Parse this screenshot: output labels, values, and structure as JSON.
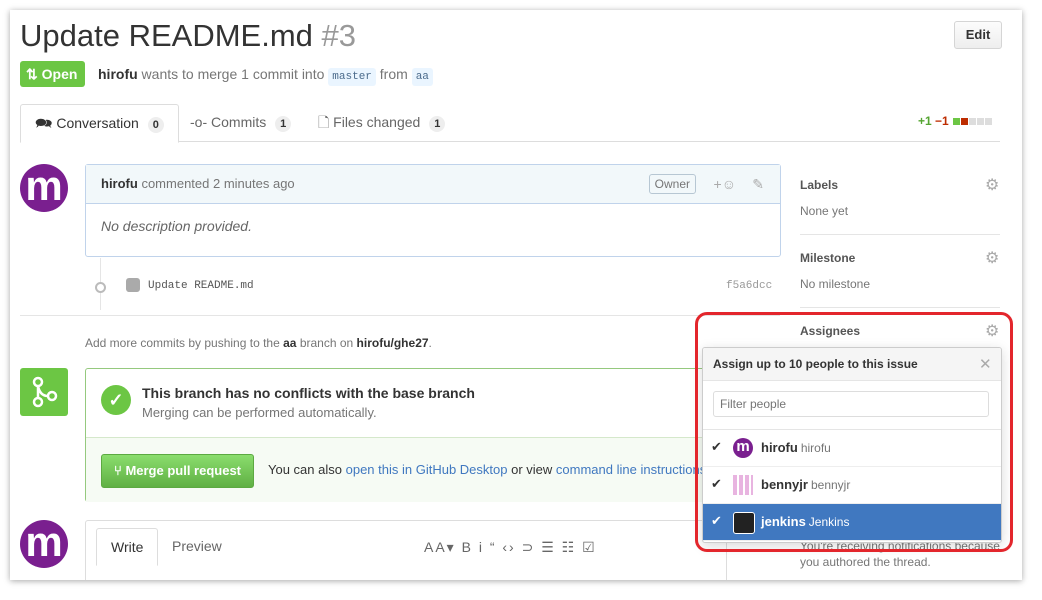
{
  "header": {
    "title": "Update README.md",
    "number": "#3",
    "edit_label": "Edit",
    "state_icon": "git-pull-request-icon",
    "state_label": "Open",
    "author": "hirofu",
    "merge_text_1": "wants to merge 1 commit into",
    "base_branch": "master",
    "merge_text_2": "from",
    "head_branch": "aa"
  },
  "tabs": [
    {
      "label": "Conversation",
      "count": "0",
      "icon": "comment-discussion-icon"
    },
    {
      "label": "Commits",
      "count": "1",
      "icon": "git-commit-icon"
    },
    {
      "label": "Files changed",
      "count": "1",
      "icon": "diff-icon"
    }
  ],
  "diffstat": {
    "additions": "+1",
    "deletions": "−1"
  },
  "comment": {
    "author": "hirofu",
    "action": "commented 2 minutes ago",
    "badge": "Owner",
    "body": "No description provided."
  },
  "commit": {
    "message": "Update README.md",
    "sha": "f5a6dcc"
  },
  "push_hint": {
    "prefix": "Add more commits by pushing to the",
    "branch": "aa",
    "middle": "branch on",
    "repo": "hirofu/ghe27",
    "suffix": "."
  },
  "merge": {
    "title": "This branch has no conflicts with the base branch",
    "subtitle": "Merging can be performed automatically.",
    "button": "Merge pull request",
    "alt_prefix": "You can also",
    "alt_link1": "open this in GitHub Desktop",
    "alt_middle": "or view",
    "alt_link2": "command line instructions"
  },
  "editor": {
    "write_tab": "Write",
    "preview_tab": "Preview",
    "toolbar": "AA▾ B i  “ ‹› ⊃  ☰ ☷ ☑"
  },
  "sidebar": {
    "labels_title": "Labels",
    "labels_value": "None yet",
    "milestone_title": "Milestone",
    "milestone_value": "No milestone",
    "assignees_title": "Assignees",
    "notifications_text": "You're receiving notifications because you authored the thread."
  },
  "assignee_dropdown": {
    "title": "Assign up to 10 people to this issue",
    "filter_placeholder": "Filter people",
    "people": [
      {
        "login": "hirofu",
        "name": "hirofu",
        "checked": true,
        "selected": false
      },
      {
        "login": "bennyjr",
        "name": "bennyjr",
        "checked": true,
        "selected": false
      },
      {
        "login": "jenkins",
        "name": "Jenkins",
        "checked": true,
        "selected": true
      }
    ]
  },
  "colors": {
    "open_green": "#6cc644",
    "link_blue": "#4078c0",
    "highlight_red": "#e3262c",
    "avatar_purple": "#7a1f8f"
  }
}
